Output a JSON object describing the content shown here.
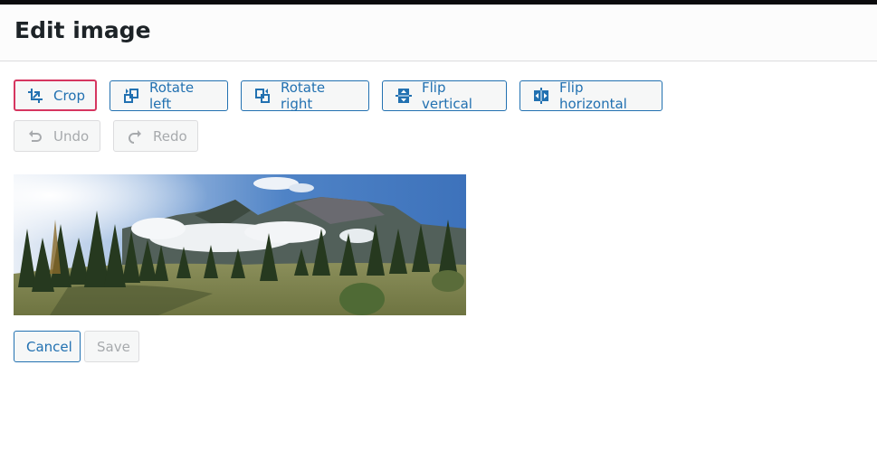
{
  "header": {
    "title": "Edit image"
  },
  "toolbar": {
    "crop": {
      "label": "Crop",
      "icon": "crop-icon"
    },
    "rotate_left": {
      "label": "Rotate left",
      "icon": "rotate-left-icon"
    },
    "rotate_right": {
      "label": "Rotate right",
      "icon": "rotate-right-icon"
    },
    "flip_vertical": {
      "label": "Flip vertical",
      "icon": "flip-vertical-icon"
    },
    "flip_horizontal": {
      "label": "Flip horizontal",
      "icon": "flip-horizontal-icon"
    },
    "undo": {
      "label": "Undo",
      "icon": "undo-icon",
      "disabled": true
    },
    "redo": {
      "label": "Redo",
      "icon": "redo-icon",
      "disabled": true
    }
  },
  "image": {
    "alt": "Panoramic mountain landscape with clouds, pine trees and meadow"
  },
  "actions": {
    "cancel": "Cancel",
    "save": "Save",
    "save_disabled": true
  },
  "colors": {
    "accent": "#2271b1",
    "focus": "#d63660",
    "disabled_text": "#a7aaad",
    "title": "#1d2327"
  }
}
